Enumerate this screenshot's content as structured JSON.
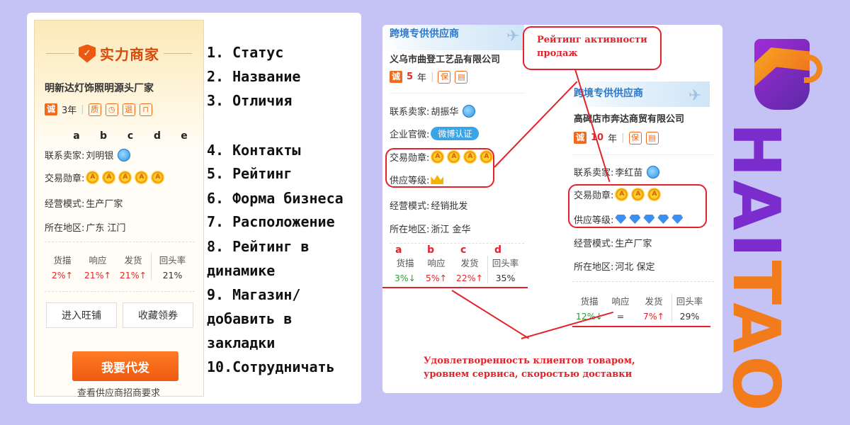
{
  "left_card": {
    "badge": "实力商家",
    "company": "明新达灯饰照明源头厂家",
    "years": "3年",
    "letters": [
      "a",
      "b",
      "c",
      "d",
      "e"
    ],
    "contact_label": "联系卖家:",
    "contact_value": "刘明银",
    "medal_label": "交易勋章:",
    "model_label": "经营模式:",
    "model_value": "生产厂家",
    "region_label": "所在地区:",
    "region_value": "广东 江门",
    "stats": [
      {
        "label": "货描",
        "value": "2%↑"
      },
      {
        "label": "响应",
        "value": "21%↑"
      },
      {
        "label": "发货",
        "value": "21%↑"
      },
      {
        "label": "回头率",
        "value": "21%"
      }
    ],
    "btn_shop": "进入旺铺",
    "btn_fav": "收藏领券",
    "btn_main": "我要代发",
    "sub_link": "查看供应商招商要求"
  },
  "legend": [
    "1. Статус",
    "2. Название",
    "3. Отличия",
    "4. Контакты",
    "5. Рейтинг",
    "6. Форма бизнеса",
    "7. Расположение",
    "8. Рейтинг в",
    "динамике",
    "9. Магазин/",
    "добавить в",
    "закладки",
    "10.Сотрудничать"
  ],
  "card_b": {
    "header": "跨境专供供应商",
    "company": "义乌市曲登工艺品有限公司",
    "years": "5",
    "years_unit": "年",
    "contact_label": "联系卖家:",
    "contact_value": "胡振华",
    "official_label": "企业官微:",
    "weibo": "微博认证",
    "medal_label": "交易勋章:",
    "supply_label": "供应等级:",
    "model_label": "经营模式:",
    "model_value": "经销批发",
    "region_label": "所在地区:",
    "region_value": "浙江 金华",
    "stat_letters": [
      "a",
      "b",
      "c",
      "d"
    ],
    "stats": [
      {
        "label": "货描",
        "value": "3%↓"
      },
      {
        "label": "响应",
        "value": "5%↑"
      },
      {
        "label": "发货",
        "value": "22%↑"
      },
      {
        "label": "回头率",
        "value": "35%"
      }
    ]
  },
  "card_c": {
    "header": "跨境专供供应商",
    "company": "高碑店市奔达商贸有限公司",
    "years": "10",
    "years_unit": "年",
    "contact_label": "联系卖家:",
    "contact_value": "李红苗",
    "medal_label": "交易勋章:",
    "supply_label": "供应等级:",
    "model_label": "经营模式:",
    "model_value": "生产厂家",
    "region_label": "所在地区:",
    "region_value": "河北 保定",
    "stats": [
      {
        "label": "货描",
        "value": "12%↓"
      },
      {
        "label": "响应",
        "value": "="
      },
      {
        "label": "发货",
        "value": "7%↑"
      },
      {
        "label": "回头率",
        "value": "29%"
      }
    ]
  },
  "annotations": {
    "top_line1": "Рейтинг активности",
    "top_line2": "продаж",
    "bottom_line1": "Удовлетворенность клиентов товаром,",
    "bottom_line2": "уровнем сервиса, скоростью доставки"
  },
  "logo": {
    "text_1": "HAI",
    "text_2": "TAO"
  },
  "colors": {
    "background": "#c5c2f6",
    "accent_orange": "#ee5a10",
    "annotation_red": "#e3222a",
    "logo_purple": "#7a2ccc",
    "logo_orange": "#f27c1c"
  }
}
